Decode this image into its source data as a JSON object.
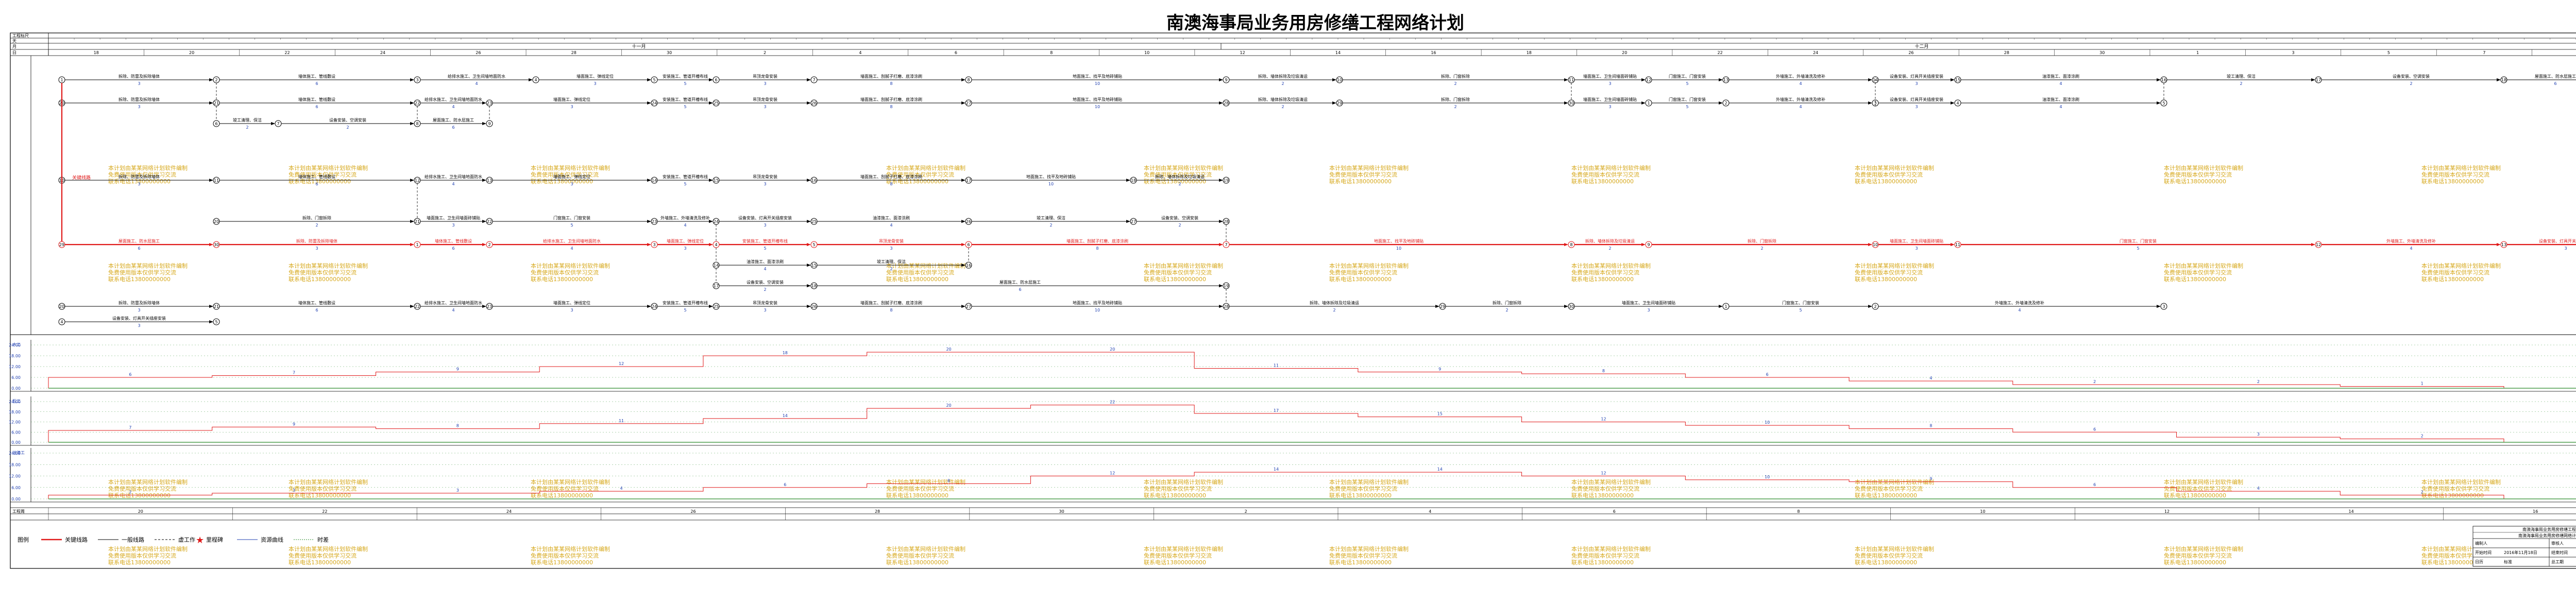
{
  "title": "南澳海事局业务用房修缮工程网络计划",
  "header": {
    "row_labels": [
      "工程标尺",
      "天",
      "月",
      "日"
    ],
    "month_labels": [
      "十一月",
      "十二月"
    ],
    "day_scale": [
      "18",
      "20",
      "22",
      "24",
      "26",
      "28",
      "30",
      "2",
      "4",
      "6",
      "8",
      "10",
      "12",
      "14",
      "16",
      "18",
      "20",
      "22",
      "24",
      "26",
      "28",
      "30",
      "1",
      "3",
      "5",
      "7",
      "9"
    ]
  },
  "colors": {
    "critical": "#e01818",
    "normal": "#000000",
    "resource": "#e01818",
    "baseline": "#2a8a2a",
    "watermark": "#d7a91e",
    "labels": "#1f3fb0"
  },
  "activities": [
    {
      "label": "拆除、防雷及拆除墙体",
      "duration": "3"
    },
    {
      "label": "墙体施工、管线敷设",
      "duration": "6"
    },
    {
      "label": "给排水施工、卫生间墙地面防水",
      "duration": "4"
    },
    {
      "label": "墙面施工、弹线定位",
      "duration": "3"
    },
    {
      "label": "安装施工、管道开槽布线",
      "duration": "5"
    },
    {
      "label": "吊顶龙骨安装",
      "duration": "3"
    },
    {
      "label": "墙面施工、刮腻子打磨、底漆涂刷",
      "duration": "8"
    },
    {
      "label": "地面施工、找平及地砖铺贴",
      "duration": "10"
    },
    {
      "label": "拆除、墙体拆除及垃圾清运",
      "duration": "2"
    },
    {
      "label": "拆除、门窗拆除",
      "duration": "2"
    },
    {
      "label": "墙面施工、卫生间墙面砖铺贴",
      "duration": "3"
    },
    {
      "label": "门窗施工、门窗安装",
      "duration": "5"
    },
    {
      "label": "外墙施工、外墙清洗及修补",
      "duration": "4"
    },
    {
      "label": "设备安装、灯具开关插座安装",
      "duration": "3"
    },
    {
      "label": "油漆施工、面漆涂刷",
      "duration": "4"
    },
    {
      "label": "竣工清理、保洁",
      "duration": "2"
    },
    {
      "label": "设备安装、空调安装",
      "duration": "2"
    },
    {
      "label": "屋面施工、防水层施工",
      "duration": "6"
    }
  ],
  "critical_path_label": "关键线路",
  "nodes": [
    "1",
    "2",
    "3",
    "4",
    "5",
    "6",
    "7",
    "8",
    "9",
    "10",
    "11",
    "12",
    "13",
    "14",
    "15",
    "16",
    "17",
    "18",
    "19",
    "20",
    "21",
    "22",
    "23",
    "24",
    "25",
    "26",
    "27",
    "28",
    "29",
    "30"
  ],
  "resource_panels": [
    {
      "name": "木工",
      "values": [
        6,
        7,
        9,
        12,
        18,
        20,
        20,
        11,
        9,
        8,
        6,
        4,
        2,
        2,
        1
      ]
    },
    {
      "name": "瓦工",
      "values": [
        7,
        9,
        8,
        11,
        14,
        20,
        22,
        17,
        15,
        12,
        10,
        8,
        6,
        3,
        2
      ]
    },
    {
      "name": "油漆工",
      "values": [
        2,
        3,
        3,
        4,
        6,
        8,
        12,
        14,
        14,
        12,
        10,
        9,
        6,
        4,
        2
      ]
    }
  ],
  "bottom_scale": [
    "20",
    "22",
    "24",
    "26",
    "28",
    "30",
    "2",
    "4",
    "6",
    "8",
    "10",
    "12",
    "14",
    "16"
  ],
  "bottom_label": "工程周",
  "watermark_lines": [
    "本计划由某某网络计划软件编制",
    "免费使用版本仅供学习交流",
    "联系电话13800000000"
  ],
  "legend": {
    "title": "图例",
    "items": [
      "关键线路",
      "一般线路",
      "虚工作",
      "里程碑",
      "资源曲线",
      "时差"
    ]
  },
  "title_block": {
    "project": "南澳海事局业务用房修缮工程",
    "drawing": "南澳海事局业务用房修缮网络计划",
    "rows": [
      {
        "label": "编制人",
        "value": ""
      },
      {
        "label": "审核人",
        "value": ""
      },
      {
        "label": "开始时间",
        "value": "2016年11月18日"
      },
      {
        "label": "结束时间",
        "value": "2016年12月8日"
      },
      {
        "label": "日历",
        "value": "标准"
      },
      {
        "label": "总工期",
        "value": "21天"
      }
    ]
  }
}
